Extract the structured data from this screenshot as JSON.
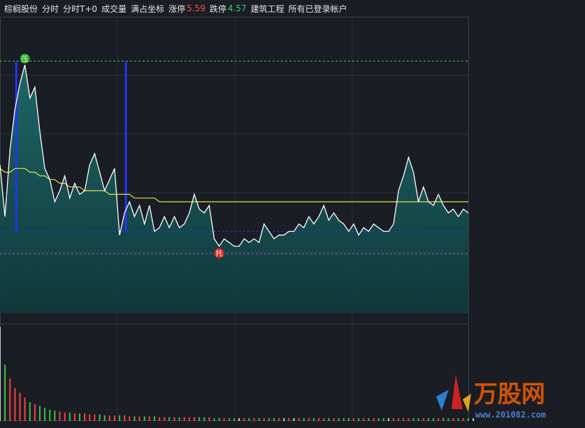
{
  "toolbar": {
    "stock_name": "棕榈股份",
    "tab_fenshi": "分时",
    "tab_t0": "分时T+0",
    "tab_volume": "成交量",
    "tab_fullscale": "满占坐标",
    "limit_up_label": "涨停",
    "limit_up_value": "5.59",
    "limit_down_label": "跌停",
    "limit_down_value": "4.57",
    "sector": "建筑工程",
    "accounts": "所有已登录帐户"
  },
  "markers": {
    "pressure": "压",
    "support": "托"
  },
  "watermark": {
    "brand": "万股网",
    "url": "www.201082.com"
  },
  "colors": {
    "background": "#1a1d24",
    "price_line": "#ffffff",
    "area_fill": "#1d6b6b",
    "avg_line": "#e8e04a",
    "blue_line": "#2233ff",
    "pressure_line": "#44cc44",
    "support_line": "#cc44cc",
    "volume_up": "#ff4040",
    "volume_down": "#40c040",
    "volume_flat": "#cccccc"
  },
  "chart_data": {
    "type": "area",
    "ylim": [
      4.8,
      5.6
    ],
    "reference_levels": {
      "pressure": 5.48,
      "base": 5.02,
      "support": 4.96
    },
    "price": [
      5.2,
      5.06,
      5.24,
      5.35,
      5.42,
      5.47,
      5.38,
      5.41,
      5.29,
      5.19,
      5.16,
      5.1,
      5.13,
      5.17,
      5.11,
      5.15,
      5.12,
      5.13,
      5.2,
      5.23,
      5.18,
      5.13,
      5.16,
      5.19,
      5.01,
      5.07,
      5.1,
      5.06,
      5.09,
      5.04,
      5.09,
      5.02,
      5.03,
      5.06,
      5.03,
      5.06,
      5.03,
      5.04,
      5.07,
      5.12,
      5.08,
      5.07,
      5.09,
      5.0,
      4.98,
      5.0,
      4.99,
      4.98,
      4.98,
      5.0,
      4.99,
      5.0,
      4.99,
      5.04,
      5.02,
      5.0,
      5.01,
      5.01,
      5.02,
      5.02,
      5.04,
      5.03,
      5.06,
      5.04,
      5.06,
      5.09,
      5.05,
      5.07,
      5.05,
      5.04,
      5.02,
      5.04,
      5.01,
      5.03,
      5.02,
      5.04,
      5.03,
      5.02,
      5.02,
      5.04,
      5.13,
      5.17,
      5.22,
      5.18,
      5.1,
      5.14,
      5.1,
      5.09,
      5.12,
      5.09,
      5.07,
      5.08,
      5.06,
      5.08,
      5.07
    ],
    "avg_price": [
      5.19,
      5.18,
      5.18,
      5.19,
      5.19,
      5.19,
      5.18,
      5.18,
      5.17,
      5.17,
      5.16,
      5.16,
      5.15,
      5.15,
      5.14,
      5.14,
      5.14,
      5.13,
      5.13,
      5.13,
      5.13,
      5.13,
      5.12,
      5.12,
      5.12,
      5.12,
      5.12,
      5.11,
      5.11,
      5.11,
      5.11,
      5.11,
      5.1,
      5.1,
      5.1,
      5.1,
      5.1,
      5.1,
      5.1,
      5.1,
      5.1,
      5.1,
      5.1,
      5.1,
      5.1,
      5.1,
      5.1,
      5.1,
      5.1,
      5.1,
      5.1,
      5.1,
      5.1,
      5.1,
      5.1,
      5.1,
      5.1,
      5.1,
      5.1,
      5.1,
      5.1,
      5.1,
      5.1,
      5.1,
      5.1,
      5.1,
      5.1,
      5.1,
      5.1,
      5.1,
      5.1,
      5.1,
      5.1,
      5.1,
      5.1,
      5.1,
      5.1,
      5.1,
      5.1,
      5.1,
      5.1,
      5.1,
      5.1,
      5.1,
      5.1,
      5.1,
      5.1,
      5.1,
      5.1,
      5.1,
      5.1,
      5.1,
      5.1,
      5.1,
      5.1
    ],
    "volume": [
      100,
      60,
      45,
      35,
      30,
      25,
      20,
      18,
      16,
      14,
      12,
      11,
      10,
      9,
      9,
      8,
      8,
      8,
      7,
      7,
      7,
      6,
      6,
      6,
      6,
      6,
      5,
      5,
      5,
      5,
      5,
      5,
      4,
      4,
      4,
      4,
      4,
      4,
      4,
      4,
      4,
      4,
      4,
      3,
      3,
      3,
      3,
      3,
      3,
      3,
      3,
      3,
      3,
      3,
      3,
      3,
      3,
      3,
      3,
      3,
      3,
      3,
      3,
      3,
      3,
      3,
      3,
      3,
      3,
      3,
      3,
      3,
      3,
      3,
      3,
      3,
      3,
      3,
      3,
      3,
      3,
      3,
      3,
      3,
      3,
      3,
      3,
      3,
      3,
      3,
      3,
      3,
      3,
      3,
      3,
      3
    ]
  }
}
